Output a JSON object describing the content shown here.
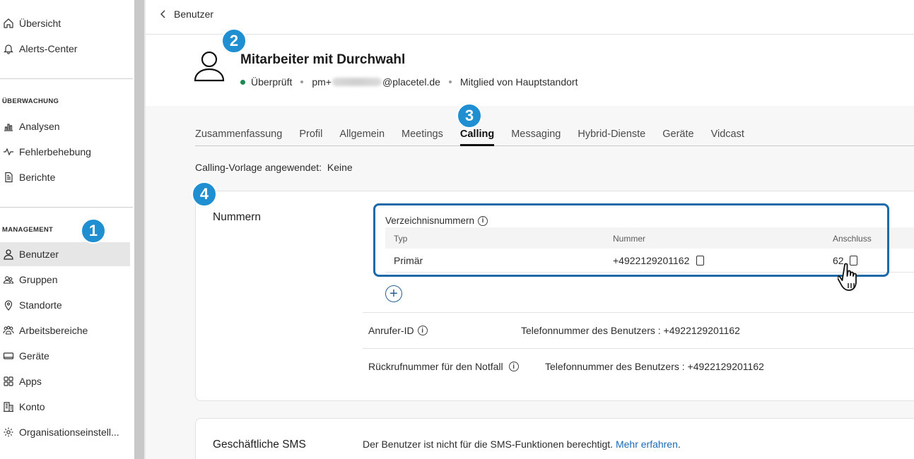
{
  "sidebar": {
    "top_items": [
      {
        "label": "Übersicht",
        "icon": "home-icon"
      },
      {
        "label": "Alerts-Center",
        "icon": "bell-icon"
      }
    ],
    "monitoring_label": "ÜBERWACHUNG",
    "monitoring_items": [
      {
        "label": "Analysen",
        "icon": "chart-icon"
      },
      {
        "label": "Fehlerbehebung",
        "icon": "pulse-icon"
      },
      {
        "label": "Berichte",
        "icon": "document-icon"
      }
    ],
    "management_label": "MANAGEMENT",
    "management_items": [
      {
        "label": "Benutzer",
        "icon": "user-icon",
        "active": true
      },
      {
        "label": "Gruppen",
        "icon": "group-icon"
      },
      {
        "label": "Standorte",
        "icon": "location-icon"
      },
      {
        "label": "Arbeitsbereiche",
        "icon": "workspace-icon"
      },
      {
        "label": "Geräte",
        "icon": "device-icon"
      },
      {
        "label": "Apps",
        "icon": "apps-icon"
      },
      {
        "label": "Konto",
        "icon": "building-icon"
      },
      {
        "label": "Organisationseinstell...",
        "icon": "gear-icon"
      }
    ]
  },
  "header": {
    "back_label": "Benutzer",
    "user_name": "Mitarbeiter mit Durchwahl",
    "status": "Überprüft",
    "email_prefix": "pm+",
    "email_domain": "@placetel.de",
    "membership": "Mitglied von Hauptstandort"
  },
  "badges": [
    "1",
    "2",
    "3",
    "4"
  ],
  "tabs": [
    {
      "label": "Zusammenfassung"
    },
    {
      "label": "Profil"
    },
    {
      "label": "Allgemein"
    },
    {
      "label": "Meetings"
    },
    {
      "label": "Calling",
      "active": true
    },
    {
      "label": "Messaging"
    },
    {
      "label": "Hybrid-Dienste"
    },
    {
      "label": "Geräte"
    },
    {
      "label": "Vidcast"
    }
  ],
  "template": {
    "label": "Calling-Vorlage angewendet:",
    "value": "Keine"
  },
  "numbers": {
    "title": "Nummern",
    "directory_title": "Verzeichnisnummern",
    "columns": {
      "type": "Typ",
      "number": "Nummer",
      "extension": "Anschluss"
    },
    "row": {
      "type": "Primär",
      "number": "+4922129201162",
      "extension": "62"
    },
    "caller_id_label": "Anrufer-ID",
    "caller_id_value": "Telefonnummer des Benutzers : +4922129201162",
    "callback_label": "Rückrufnummer für den Notfall",
    "callback_value": "Telefonnummer des Benutzers : +4922129201162"
  },
  "sms": {
    "title": "Geschäftliche SMS",
    "text": "Der Benutzer ist nicht für die SMS-Funktionen berechtigt.",
    "link": "Mehr erfahren",
    "trailing": "."
  },
  "colors": {
    "accent": "#1f8fd1",
    "highlight_border": "#1e6aa8",
    "status_green": "#1b8a4c",
    "link": "#1a6bb8"
  }
}
